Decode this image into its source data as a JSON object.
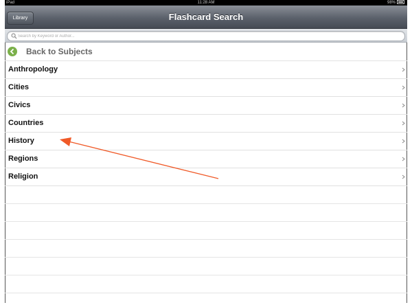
{
  "status_bar": {
    "carrier": "iPad",
    "time": "11:28 AM",
    "battery": "98%"
  },
  "nav": {
    "title": "Flashcard Search",
    "library_label": "Library"
  },
  "search": {
    "placeholder": "Search by Keyword or Author..."
  },
  "back": {
    "label": "Back to Subjects"
  },
  "subjects": [
    "Anthropology",
    "Cities",
    "Civics",
    "Countries",
    "History",
    "Regions",
    "Religion"
  ],
  "colors": {
    "nav_bar": "#5b616b",
    "back_icon": "#7bb04a",
    "annotation_arrow": "#f05a28"
  }
}
